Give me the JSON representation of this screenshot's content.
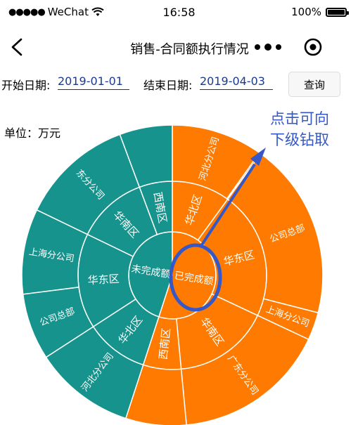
{
  "status_bar": {
    "carrier": "WeChat",
    "time": "16:58",
    "battery": "100%"
  },
  "nav": {
    "title": "销售-合同额执行情况"
  },
  "filter": {
    "start_label": "开始日期:",
    "start_value": "2019-01-01",
    "end_label": "结束日期:",
    "end_value": "2019-04-03",
    "query_label": "查询"
  },
  "unit_label": "单位：万元",
  "annotation": [
    "点击可向",
    "下级钻取"
  ],
  "chart_data": {
    "type": "sunburst",
    "colors": {
      "completed": "#fe7a00",
      "uncompleted": "#15938c",
      "annotation": "#3558c8"
    },
    "start_angle_deg": 0,
    "rings": [
      {
        "level": 1,
        "segments": [
          {
            "label": "已完成额",
            "group": "completed",
            "value": 3.3
          },
          {
            "label": "未完成额",
            "group": "uncompleted",
            "value": 2.7
          }
        ]
      },
      {
        "level": 2,
        "segments": [
          {
            "label": "华北区",
            "group": "completed",
            "value": 0.6
          },
          {
            "label": "华东区",
            "group": "completed",
            "value": 1.32
          },
          {
            "label": "华南区",
            "group": "completed",
            "value": 0.99
          },
          {
            "label": "西南区",
            "group": "completed",
            "value": 0.39
          },
          {
            "label": "华北区",
            "group": "uncompleted",
            "value": 0.65
          },
          {
            "label": "华东区",
            "group": "uncompleted",
            "value": 0.98
          },
          {
            "label": "华南区",
            "group": "uncompleted",
            "value": 0.73
          },
          {
            "label": "西南区",
            "group": "uncompleted",
            "value": 0.34
          }
        ]
      },
      {
        "level": 3,
        "segments": [
          {
            "label": "河北分公司",
            "group": "completed",
            "value": 0.59
          },
          {
            "label": "",
            "group": "completed",
            "value": 0.01
          },
          {
            "label": "公司总部",
            "group": "completed",
            "value": 1.14
          },
          {
            "label": "上海分公司",
            "group": "completed",
            "value": 0.18
          },
          {
            "label": "广东分公司",
            "group": "completed",
            "value": 0.99
          },
          {
            "label": "",
            "group": "completed",
            "value": 0.39
          },
          {
            "label": "河北分公司",
            "group": "uncompleted",
            "value": 0.65
          },
          {
            "label": "公司总部",
            "group": "uncompleted",
            "value": 0.43
          },
          {
            "label": "上海分公司",
            "group": "uncompleted",
            "value": 0.55
          },
          {
            "label": "东分公司",
            "group": "uncompleted",
            "value": 0.73
          },
          {
            "label": "",
            "group": "uncompleted",
            "value": 0.34
          }
        ]
      }
    ]
  }
}
